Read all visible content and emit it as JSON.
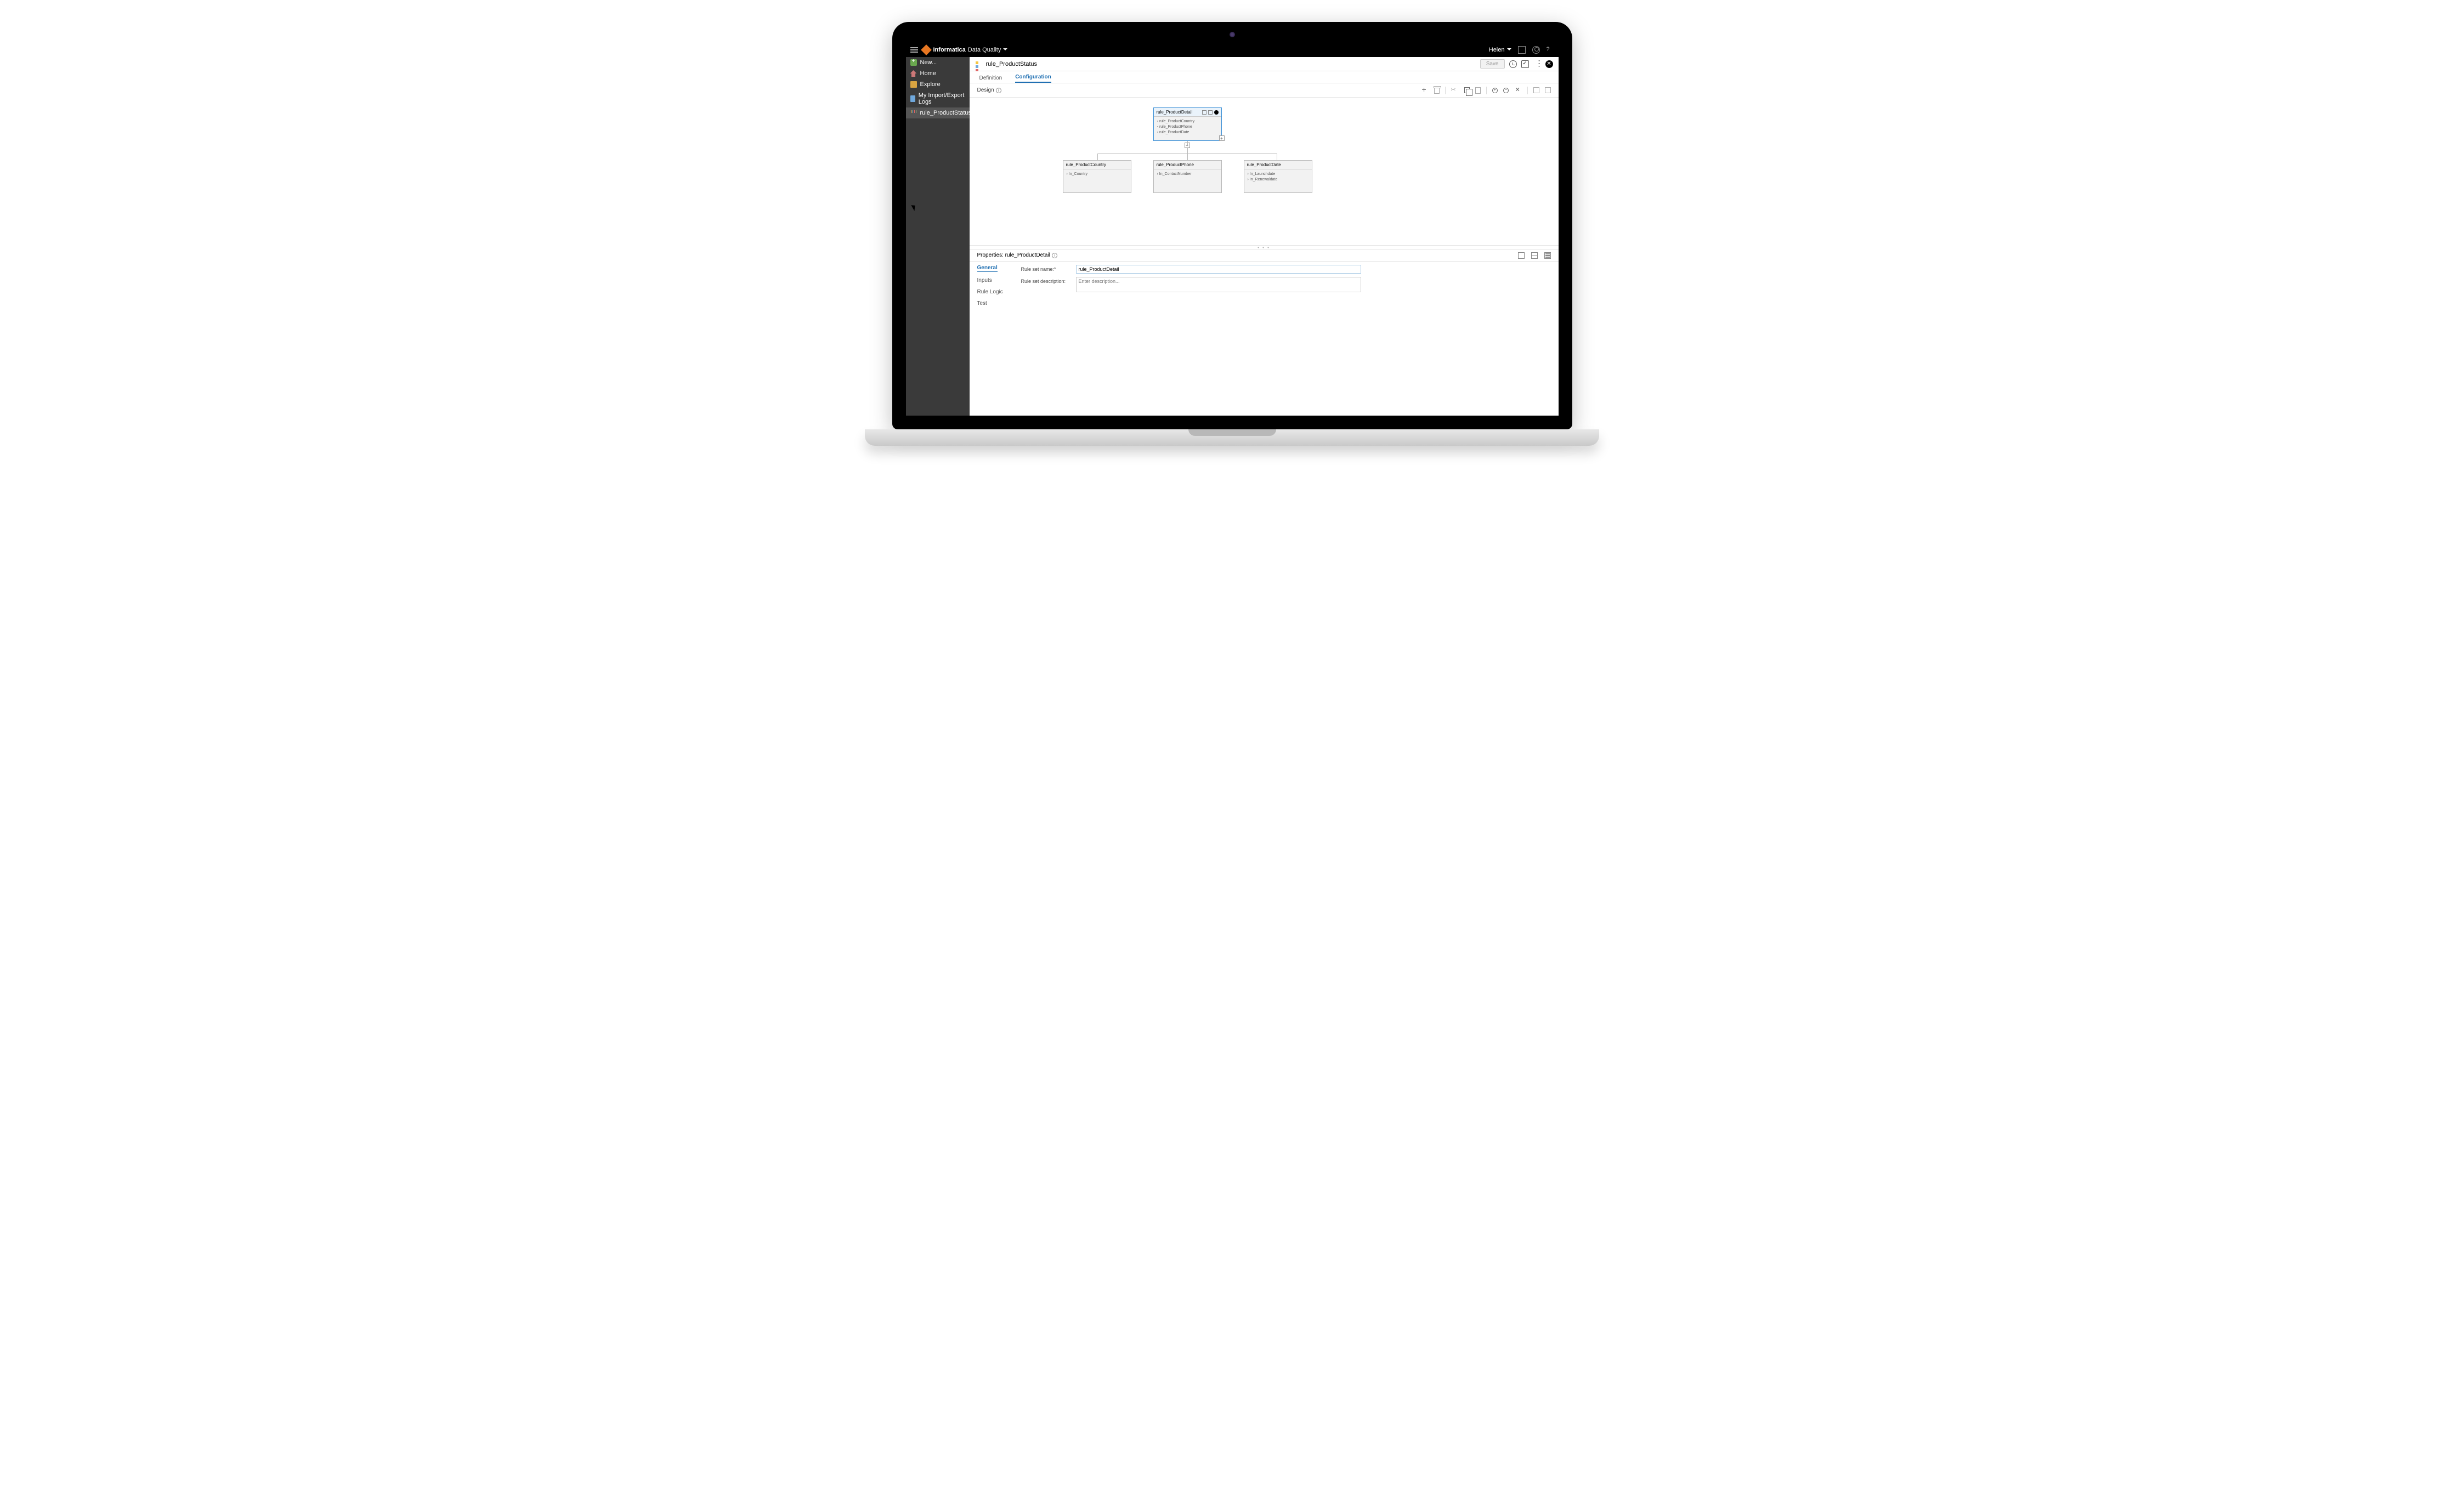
{
  "header": {
    "brand": "Informatica",
    "product": "Data Quality",
    "user": "Helen"
  },
  "sidebar": {
    "items": [
      {
        "label": "New..."
      },
      {
        "label": "Home"
      },
      {
        "label": "Explore"
      },
      {
        "label": "My Import/Export Logs"
      },
      {
        "label": "rule_ProductStatus"
      }
    ]
  },
  "page": {
    "title": "rule_ProductStatus",
    "save_label": "Save",
    "tabs": {
      "definition": "Definition",
      "configuration": "Configuration"
    },
    "design_label": "Design"
  },
  "canvas": {
    "parent": {
      "title": "rule_ProductDetail",
      "items": [
        "rule_ProductCountry",
        "rule_ProductPhone",
        "rule_ProductDate"
      ]
    },
    "children": [
      {
        "title": "rule_ProductCountry",
        "items": [
          "In_Country"
        ]
      },
      {
        "title": "rule_ProductPhone",
        "items": [
          "In_ContactNumber"
        ]
      },
      {
        "title": "rule_ProductDate",
        "items": [
          "In_Launchdate",
          "In_Renewaldate"
        ]
      }
    ]
  },
  "properties": {
    "title": "Properties: rule_ProductDetail",
    "side_tabs": {
      "general": "General",
      "inputs": "Inputs",
      "rule_logic": "Rule Logic",
      "test": "Test"
    },
    "name_label": "Rule set name:*",
    "name_value": "rule_ProductDetail",
    "desc_label": "Rule set description:",
    "desc_placeholder": "Enter description..."
  }
}
